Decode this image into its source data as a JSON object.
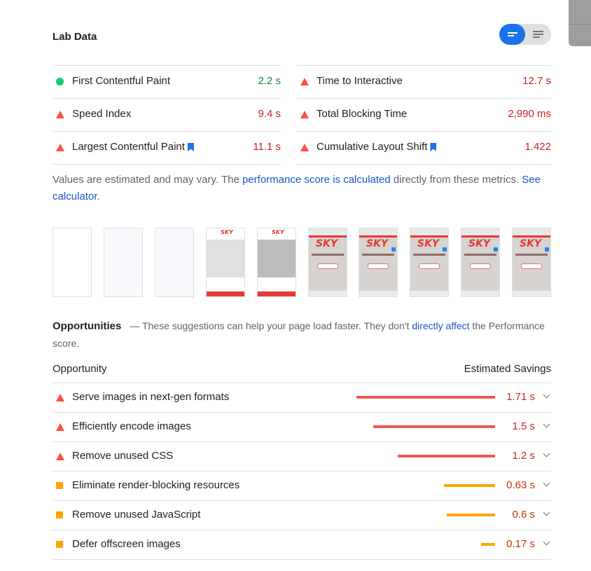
{
  "lab": {
    "title": "Lab Data",
    "view_toggle": {
      "selected": "bars-view",
      "options": [
        "bars-view",
        "list-view"
      ]
    },
    "metrics_left": [
      {
        "label": "First Contentful Paint",
        "value": "2.2 s",
        "status": "good",
        "icon": "green-circle-icon",
        "bookmark": false
      },
      {
        "label": "Speed Index",
        "value": "9.4 s",
        "status": "bad",
        "icon": "red-triangle-icon",
        "bookmark": false
      },
      {
        "label": "Largest Contentful Paint",
        "value": "11.1 s",
        "status": "bad",
        "icon": "red-triangle-icon",
        "bookmark": true
      }
    ],
    "metrics_right": [
      {
        "label": "Time to Interactive",
        "value": "12.7 s",
        "status": "bad",
        "icon": "red-triangle-icon",
        "bookmark": false
      },
      {
        "label": "Total Blocking Time",
        "value": "2,990 ms",
        "status": "bad",
        "icon": "red-triangle-icon",
        "bookmark": false
      },
      {
        "label": "Cumulative Layout Shift",
        "value": "1.422",
        "status": "bad",
        "icon": "red-triangle-icon",
        "bookmark": true
      }
    ],
    "note": {
      "text1": "Values are estimated and may vary. The ",
      "link1": "performance score is calculated",
      "text2": " directly from these metrics. ",
      "link2": "See calculator",
      "text3": "."
    },
    "filmstrip_logo": "SKY"
  },
  "opportunities": {
    "title": "Opportunities",
    "desc1": "— These suggestions can help your page load faster. They don't ",
    "desc_link": "directly affect",
    "desc2": " the Performance score.",
    "col_opportunity": "Opportunity",
    "col_savings": "Estimated Savings",
    "items": [
      {
        "label": "Serve images in next-gen formats",
        "savings": "1.71 s",
        "severity": "red",
        "fraction": 1.0
      },
      {
        "label": "Efficiently encode images",
        "savings": "1.5 s",
        "severity": "red",
        "fraction": 0.877
      },
      {
        "label": "Remove unused CSS",
        "savings": "1.2 s",
        "severity": "red",
        "fraction": 0.702
      },
      {
        "label": "Eliminate render-blocking resources",
        "savings": "0.63 s",
        "severity": "orange",
        "fraction": 0.368
      },
      {
        "label": "Remove unused JavaScript",
        "savings": "0.6 s",
        "severity": "orange",
        "fraction": 0.351
      },
      {
        "label": "Defer offscreen images",
        "savings": "0.17 s",
        "severity": "orange",
        "fraction": 0.099
      }
    ]
  },
  "colors": {
    "good": "#0cce6b",
    "bad": "#ff4e42",
    "average": "#ffa400",
    "accent": "#1a73e8"
  }
}
